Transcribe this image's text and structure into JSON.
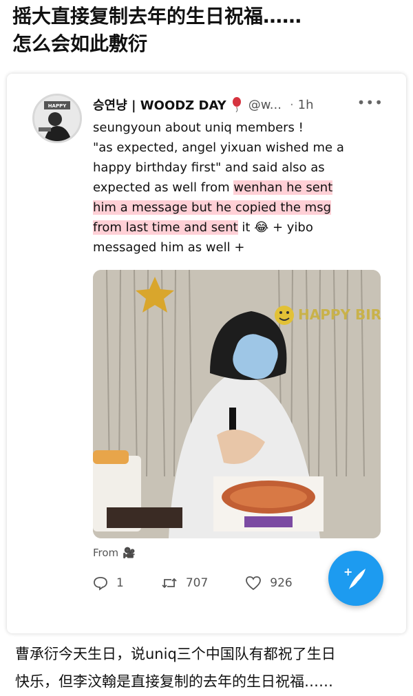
{
  "headline": {
    "line1": "摇大直接复制去年的生日祝福……",
    "line2": "怎么会如此敷衍"
  },
  "tweet": {
    "display_name": "승연냥 | WOODZ DAY",
    "badge_icon": "balloon-icon",
    "handle": "@w...",
    "separator": "·",
    "time": "1h",
    "more_icon": "more-horizontal-icon",
    "avatar_text": "HAPPY WOODZ DAY",
    "text_lines": [
      [
        {
          "t": "seungyoun about uniq members !",
          "hl": false
        }
      ],
      [
        {
          "t": "\"as expected, angel yixuan wished me a",
          "hl": false
        }
      ],
      [
        {
          "t": "happy birthday first\" and said also as",
          "hl": false
        }
      ],
      [
        {
          "t": "expected as well from ",
          "hl": false
        },
        {
          "t": "wenhan he sent",
          "hl": true
        }
      ],
      [
        {
          "t": "him a message but he copied the msg",
          "hl": true
        }
      ],
      [
        {
          "t": "from last time and sent",
          "hl": true
        },
        {
          "t": " it 😂 + yibo",
          "hl": false
        }
      ],
      [
        {
          "t": "messaged him as well +",
          "hl": false
        }
      ]
    ],
    "from_label": "From",
    "from_icon": "camera-icon",
    "media_banner": "HAPPY BIRTHDAY",
    "replies": "1",
    "retweets": "707",
    "likes": "926",
    "accent": "#1d9bf0",
    "highlight_color": "#ffaab4"
  },
  "compose_button": {
    "icon": "feather-compose-icon",
    "label": "+"
  },
  "caption": {
    "line1": "曹承衍今天生日，说uniq三个中国队有都祝了生日",
    "line2": "快乐，但李汶翰是直接复制的去年的生日祝福……"
  }
}
